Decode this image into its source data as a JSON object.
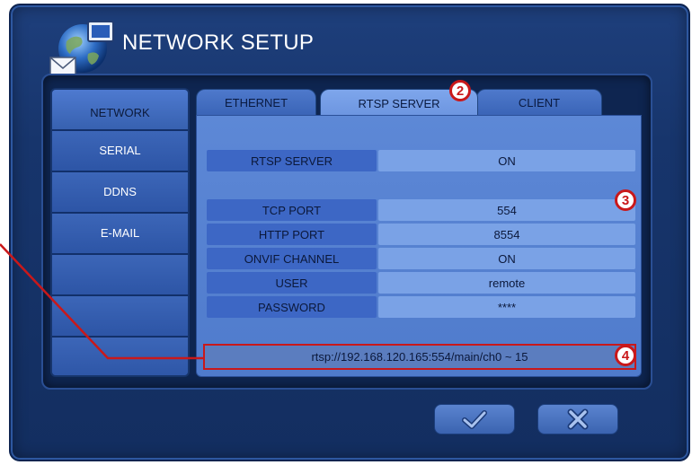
{
  "window": {
    "title": "NETWORK SETUP"
  },
  "sidebar": {
    "items": [
      {
        "label": "NETWORK",
        "active": true
      },
      {
        "label": "SERIAL"
      },
      {
        "label": "DDNS"
      },
      {
        "label": "E-MAIL"
      },
      {
        "label": ""
      },
      {
        "label": ""
      },
      {
        "label": ""
      }
    ]
  },
  "tabs": [
    {
      "label": "ETHERNET"
    },
    {
      "label": "RTSP SERVER",
      "active": true
    },
    {
      "label": "CLIENT"
    }
  ],
  "settings": {
    "rtsp_server": {
      "label": "RTSP SERVER",
      "value": "ON"
    },
    "tcp_port": {
      "label": "TCP PORT",
      "value": "554"
    },
    "http_port": {
      "label": "HTTP PORT",
      "value": "8554"
    },
    "onvif_channel": {
      "label": "ONVIF CHANNEL",
      "value": "ON"
    },
    "user": {
      "label": "USER",
      "value": "remote"
    },
    "password": {
      "label": "PASSWORD",
      "value": "****"
    }
  },
  "rtsp_url": "rtsp://192.168.120.165:554/main/ch0 ~ 15",
  "annotations": {
    "badge_2": "2",
    "badge_3": "3",
    "badge_4": "4"
  },
  "colors": {
    "callout": "#c9181a",
    "panel": "#5d88d6",
    "window": "#17356c"
  },
  "icons": {
    "logo": "globe-envelope-monitor-icon",
    "ok": "check-icon",
    "cancel": "x-icon"
  }
}
